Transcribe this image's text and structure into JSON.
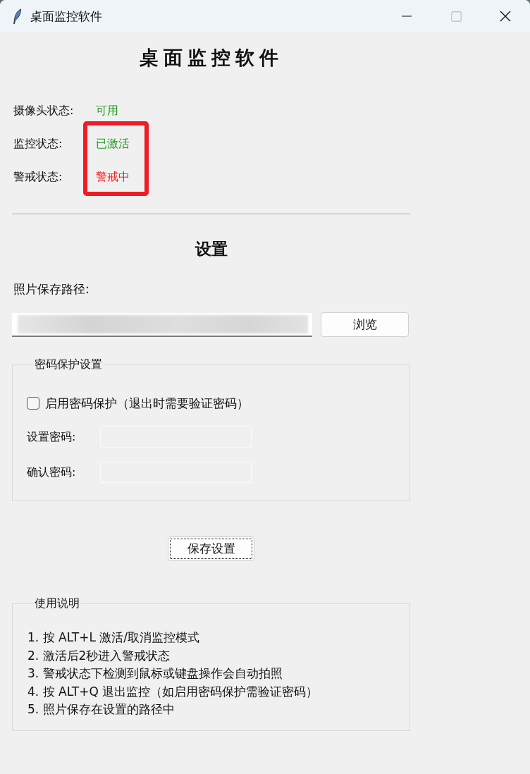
{
  "window": {
    "title": "桌面监控软件",
    "controls": [
      {
        "kind": "minimize",
        "disabled": false
      },
      {
        "kind": "maximize",
        "disabled": true
      },
      {
        "kind": "close",
        "disabled": false
      }
    ]
  },
  "heading": "桌面监控软件",
  "status": [
    {
      "label": "摄像头状态:",
      "value": "可用",
      "color": "#1f9a1f",
      "highlighted": false
    },
    {
      "label": "监控状态:",
      "value": "已激活",
      "color": "#1f9a1f",
      "highlighted": true
    },
    {
      "label": "警戒状态:",
      "value": "警戒中",
      "color": "#ff1a1a",
      "highlighted": true
    }
  ],
  "settings": {
    "heading": "设置",
    "path_label": "照片保存路径:",
    "path_field": {
      "blurred": true
    },
    "browse_button": "浏览"
  },
  "password_group": {
    "title": "密码保护设置",
    "checkbox": {
      "label": "启用密码保护（退出时需要验证密码）",
      "checked": false
    },
    "fields": [
      {
        "label": "设置密码:",
        "disabled": true
      },
      {
        "label": "确认密码:",
        "disabled": true
      }
    ]
  },
  "save_button": {
    "label": "保存设置",
    "focused": true
  },
  "usage_group": {
    "title": "使用说明",
    "lines": [
      "1. 按 ALT+L 激活/取消监控模式",
      "2. 激活后2秒进入警戒状态",
      "3. 警戒状态下检测到鼠标或键盘操作会自动拍照",
      "4. 按 ALT+Q 退出监控（如启用密码保护需验证密码）",
      "5. 照片保存在设置的路径中"
    ]
  }
}
